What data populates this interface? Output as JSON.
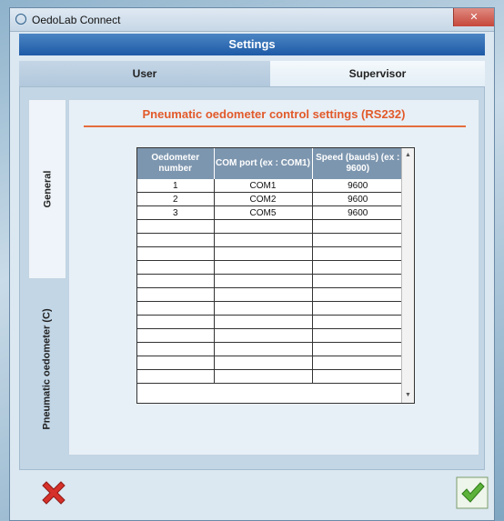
{
  "window": {
    "title": "OedoLab Connect"
  },
  "settings_bar": {
    "label": "Settings"
  },
  "tabs": [
    {
      "label": "User",
      "active": false
    },
    {
      "label": "Supervisor",
      "active": true
    }
  ],
  "side_tabs": [
    {
      "label": "General",
      "active": true
    },
    {
      "label": "Pneumatic oedometer (C)",
      "active": false
    }
  ],
  "panel": {
    "title": "Pneumatic oedometer control settings (RS232)"
  },
  "table": {
    "headers": [
      "Oedometer number",
      "COM port (ex : COM1)",
      "Speed (bauds) (ex : 9600)"
    ],
    "rows": [
      [
        "1",
        "COM1",
        "9600"
      ],
      [
        "2",
        "COM2",
        "9600"
      ],
      [
        "3",
        "COM5",
        "9600"
      ],
      [
        "",
        "",
        ""
      ],
      [
        "",
        "",
        ""
      ],
      [
        "",
        "",
        ""
      ],
      [
        "",
        "",
        ""
      ],
      [
        "",
        "",
        ""
      ],
      [
        "",
        "",
        ""
      ],
      [
        "",
        "",
        ""
      ],
      [
        "",
        "",
        ""
      ],
      [
        "",
        "",
        ""
      ],
      [
        "",
        "",
        ""
      ],
      [
        "",
        "",
        ""
      ],
      [
        "",
        "",
        ""
      ]
    ]
  },
  "colors": {
    "accent": "#e25a2a",
    "header_bg": "#7d96af",
    "title_bar": "#1e5aa6"
  },
  "icons": {
    "cancel": "red-x-icon",
    "ok": "green-check-icon"
  }
}
